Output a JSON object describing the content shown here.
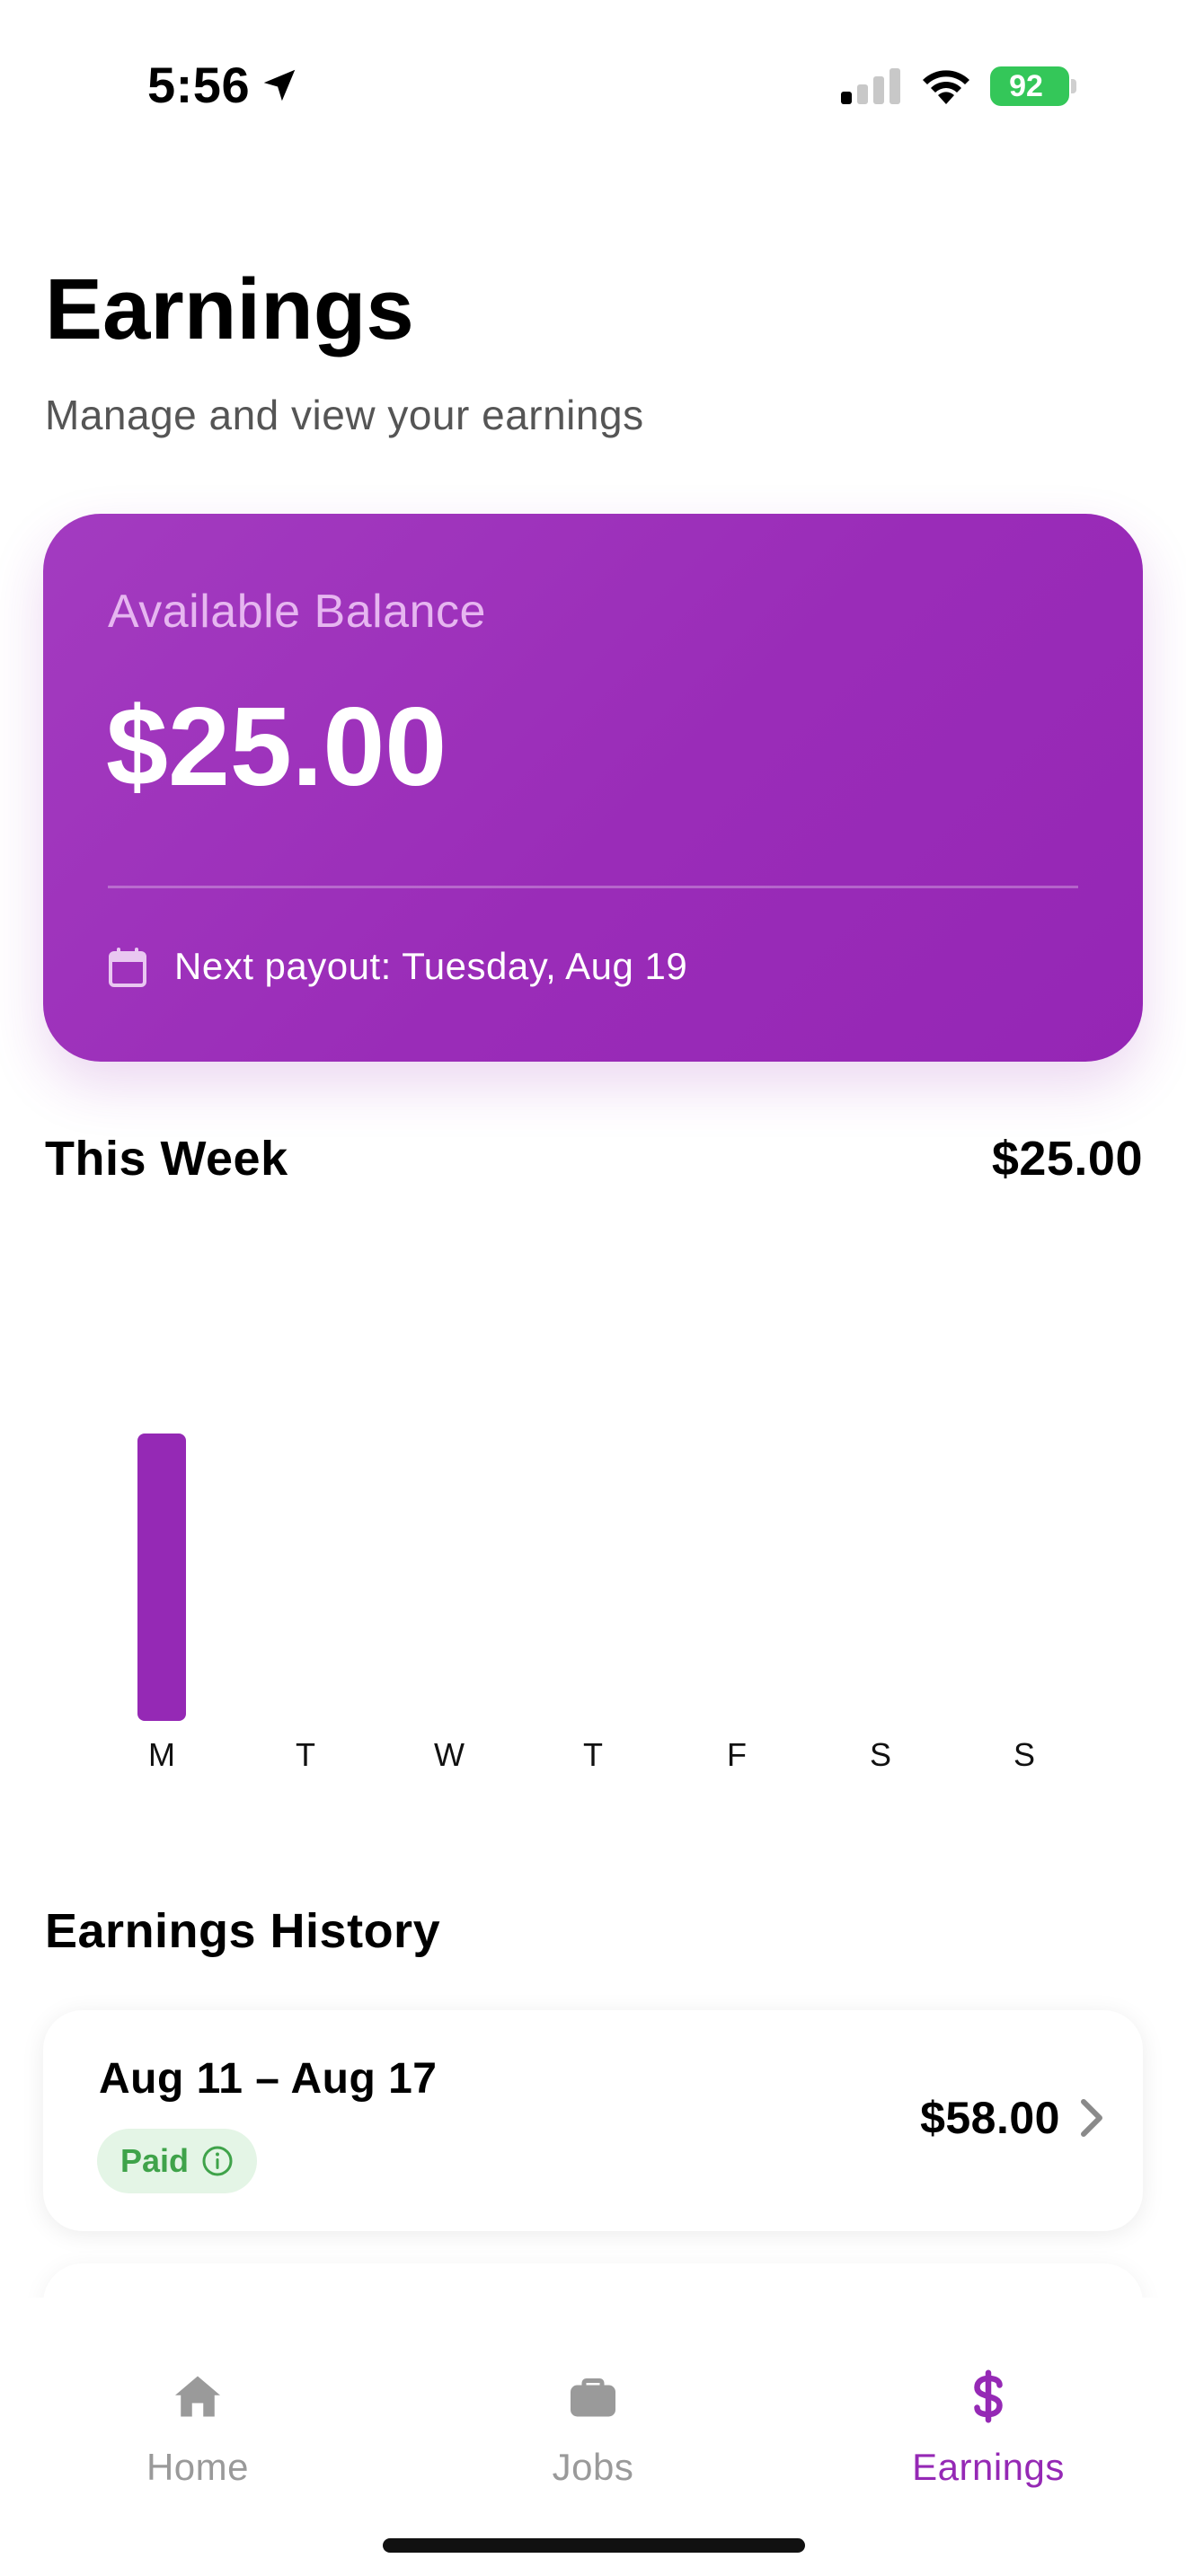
{
  "status_bar": {
    "time": "5:56",
    "battery_percent": "92",
    "battery_color": "#34c759",
    "signal_bars_active": 1,
    "signal_bars_total": 4,
    "icons": [
      "location-arrow-icon",
      "cellular-signal-icon",
      "wifi-icon",
      "battery-charging-icon"
    ]
  },
  "header": {
    "title": "Earnings",
    "subtitle": "Manage and view your earnings"
  },
  "balance_card": {
    "label": "Available Balance",
    "amount": "$25.00",
    "payout_text": "Next payout: Tuesday, Aug 19",
    "icon": "calendar-icon",
    "accent_color": "#9a2cb8"
  },
  "this_week": {
    "title": "This Week",
    "total": "$25.00"
  },
  "chart_data": {
    "type": "bar",
    "categories": [
      "M",
      "T",
      "W",
      "T",
      "F",
      "S",
      "S"
    ],
    "values": [
      25,
      0,
      0,
      0,
      0,
      0,
      0
    ],
    "ylim": [
      0,
      25
    ],
    "grid": false,
    "bar_color": "#9529b5"
  },
  "history": {
    "title": "Earnings History",
    "items": [
      {
        "range": "Aug 11 – Aug 17",
        "status": "Paid",
        "amount": "$58.00",
        "status_color": "#3fa34a"
      }
    ]
  },
  "tab_bar": {
    "tabs": [
      {
        "label": "Home",
        "icon": "home-icon",
        "active": false
      },
      {
        "label": "Jobs",
        "icon": "briefcase-icon",
        "active": false
      },
      {
        "label": "Earnings",
        "icon": "dollar-icon",
        "active": true
      }
    ],
    "active_color": "#9529b5",
    "inactive_color": "#9a9a9a"
  }
}
